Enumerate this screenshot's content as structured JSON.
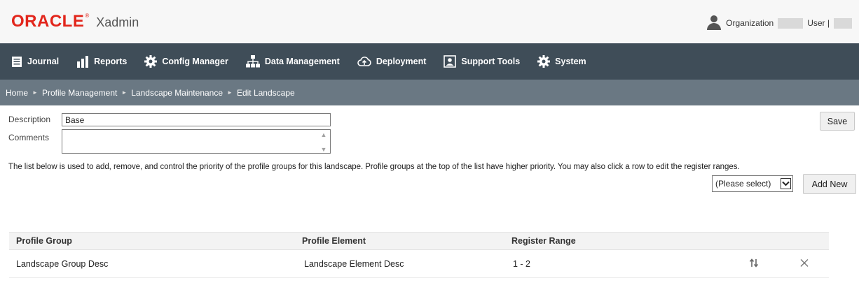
{
  "header": {
    "logo_text": "ORACLE",
    "logo_mark": "®",
    "app_name": "Xadmin",
    "organization_label": "Organization",
    "user_label": "User |"
  },
  "nav": {
    "items": [
      {
        "label": "Journal",
        "icon": "journal-icon"
      },
      {
        "label": "Reports",
        "icon": "reports-icon"
      },
      {
        "label": "Config Manager",
        "icon": "gear-icon"
      },
      {
        "label": "Data Management",
        "icon": "hierarchy-icon"
      },
      {
        "label": "Deployment",
        "icon": "cloud-upload-icon"
      },
      {
        "label": "Support Tools",
        "icon": "support-tools-icon"
      },
      {
        "label": "System",
        "icon": "gear-icon"
      }
    ]
  },
  "breadcrumb": {
    "items": [
      "Home",
      "Profile Management",
      "Landscape Maintenance",
      "Edit Landscape"
    ],
    "separator": "►"
  },
  "form": {
    "description_label": "Description",
    "description_value": "Base",
    "comments_label": "Comments",
    "comments_value": "",
    "save_label": "Save",
    "info_text": "The list below is used to add, remove, and control the priority of the profile groups for this landscape. Profile groups at the top of the list have higher priority. You may also click a row to edit the register ranges.",
    "select_value": "(Please select)",
    "add_new_label": "Add New"
  },
  "table": {
    "columns": [
      "Profile Group",
      "Profile Element",
      "Register Range"
    ],
    "rows": [
      {
        "profile_group": "Landscape Group Desc",
        "profile_element": "Landscape Element Desc",
        "register_range": "1 - 2"
      }
    ]
  },
  "colors": {
    "brand_red": "#e2261c",
    "navbar": "#3f4d58",
    "breadcrumb_bar": "#6a7883"
  }
}
